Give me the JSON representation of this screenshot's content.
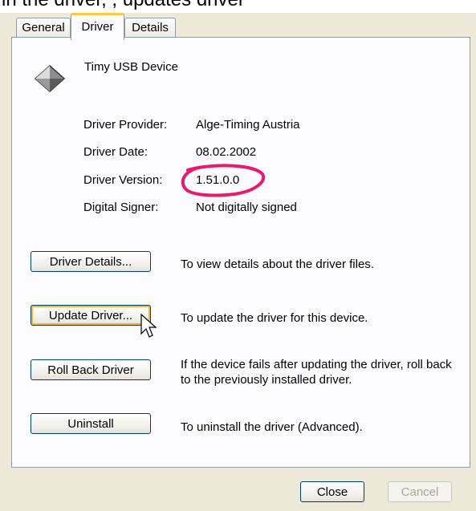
{
  "header_fragment": "in the driver, , updates driver",
  "tabs": [
    {
      "label": "General"
    },
    {
      "label": "Driver"
    },
    {
      "label": "Details"
    }
  ],
  "device": {
    "name": "Timy USB Device",
    "icon": "usb-device-diamond-icon"
  },
  "properties": [
    {
      "label": "Driver Provider:",
      "value": "Alge-Timing Austria"
    },
    {
      "label": "Driver Date:",
      "value": "08.02.2002"
    },
    {
      "label": "Driver Version:",
      "value": "1.51.0.0"
    },
    {
      "label": "Digital Signer:",
      "value": "Not digitally signed"
    }
  ],
  "actions": [
    {
      "button": "Driver Details...",
      "description": "To view details about the driver files."
    },
    {
      "button": "Update Driver...",
      "description": "To update the driver for this device."
    },
    {
      "button": "Roll Back Driver",
      "description": "If the device fails after updating the driver, roll back to the previously installed driver."
    },
    {
      "button": "Uninstall",
      "description": "To uninstall the driver (Advanced)."
    }
  ],
  "footer": {
    "close_label": "Close",
    "cancel_label": "Cancel"
  },
  "annotation_color": "#e8196e",
  "tab_highlight_color": "#ffc83c"
}
